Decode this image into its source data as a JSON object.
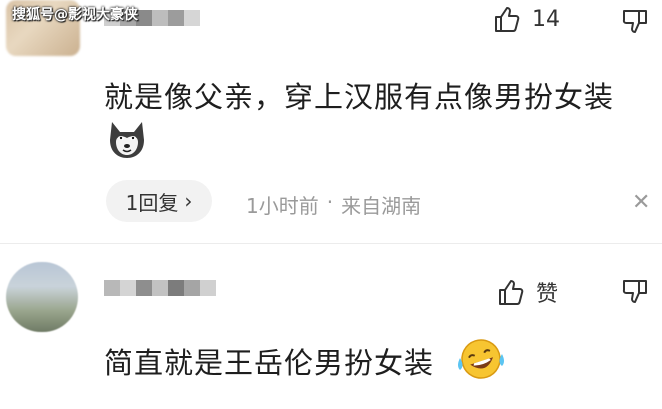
{
  "watermark": "搜狐号@影视大豪侠",
  "comment1": {
    "like_count": "14",
    "text": "就是像父亲，穿上汉服有点像男扮女装",
    "emoji": "dog-emoji",
    "reply_count_label": "1回复",
    "reply_chevron": "›",
    "time": "1小时前",
    "dot": "·",
    "location": "来自湖南",
    "close": "✕"
  },
  "comment2": {
    "like_label": "赞",
    "text": "简直就是王岳伦男扮女装",
    "emoji": "laughing-tears-emoji"
  },
  "colors": {
    "text": "#1e1e1e",
    "meta": "#9a9a9a",
    "pill_bg": "#f2f2f2"
  }
}
